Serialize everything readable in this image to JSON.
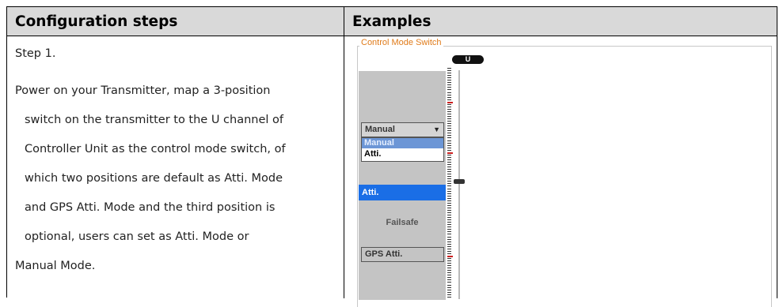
{
  "header": {
    "left_title": "Configuration steps",
    "right_title": "Examples"
  },
  "left": {
    "step_label": "Step 1.",
    "paragraph_lines": [
      "Power on your Transmitter, map a 3-position",
      "switch on the transmitter to the U channel of",
      "Controller Unit as the control mode switch, of",
      "which two positions are default as Atti. Mode",
      "and GPS Atti. Mode and the third position is",
      "optional, users can set as Atti. Mode or",
      "Manual Mode."
    ]
  },
  "example": {
    "section_title": "Control Mode Switch",
    "channel_label": "U",
    "dropdown_value": "Manual",
    "dropdown_options": [
      "Manual",
      "Atti."
    ],
    "ghost_label": "Failsafe",
    "selected_mode": "Atti.",
    "failsafe_label": "Failsafe",
    "gps_mode": "GPS Atti.",
    "colors": {
      "title_orange": "#e07b1a",
      "selected_blue": "#1a6ee6",
      "panel_gray": "#c4c4c4",
      "tick_red": "#cc1f1f"
    },
    "icons": [
      "dropdown-arrow-icon",
      "slider-handle-icon"
    ]
  }
}
